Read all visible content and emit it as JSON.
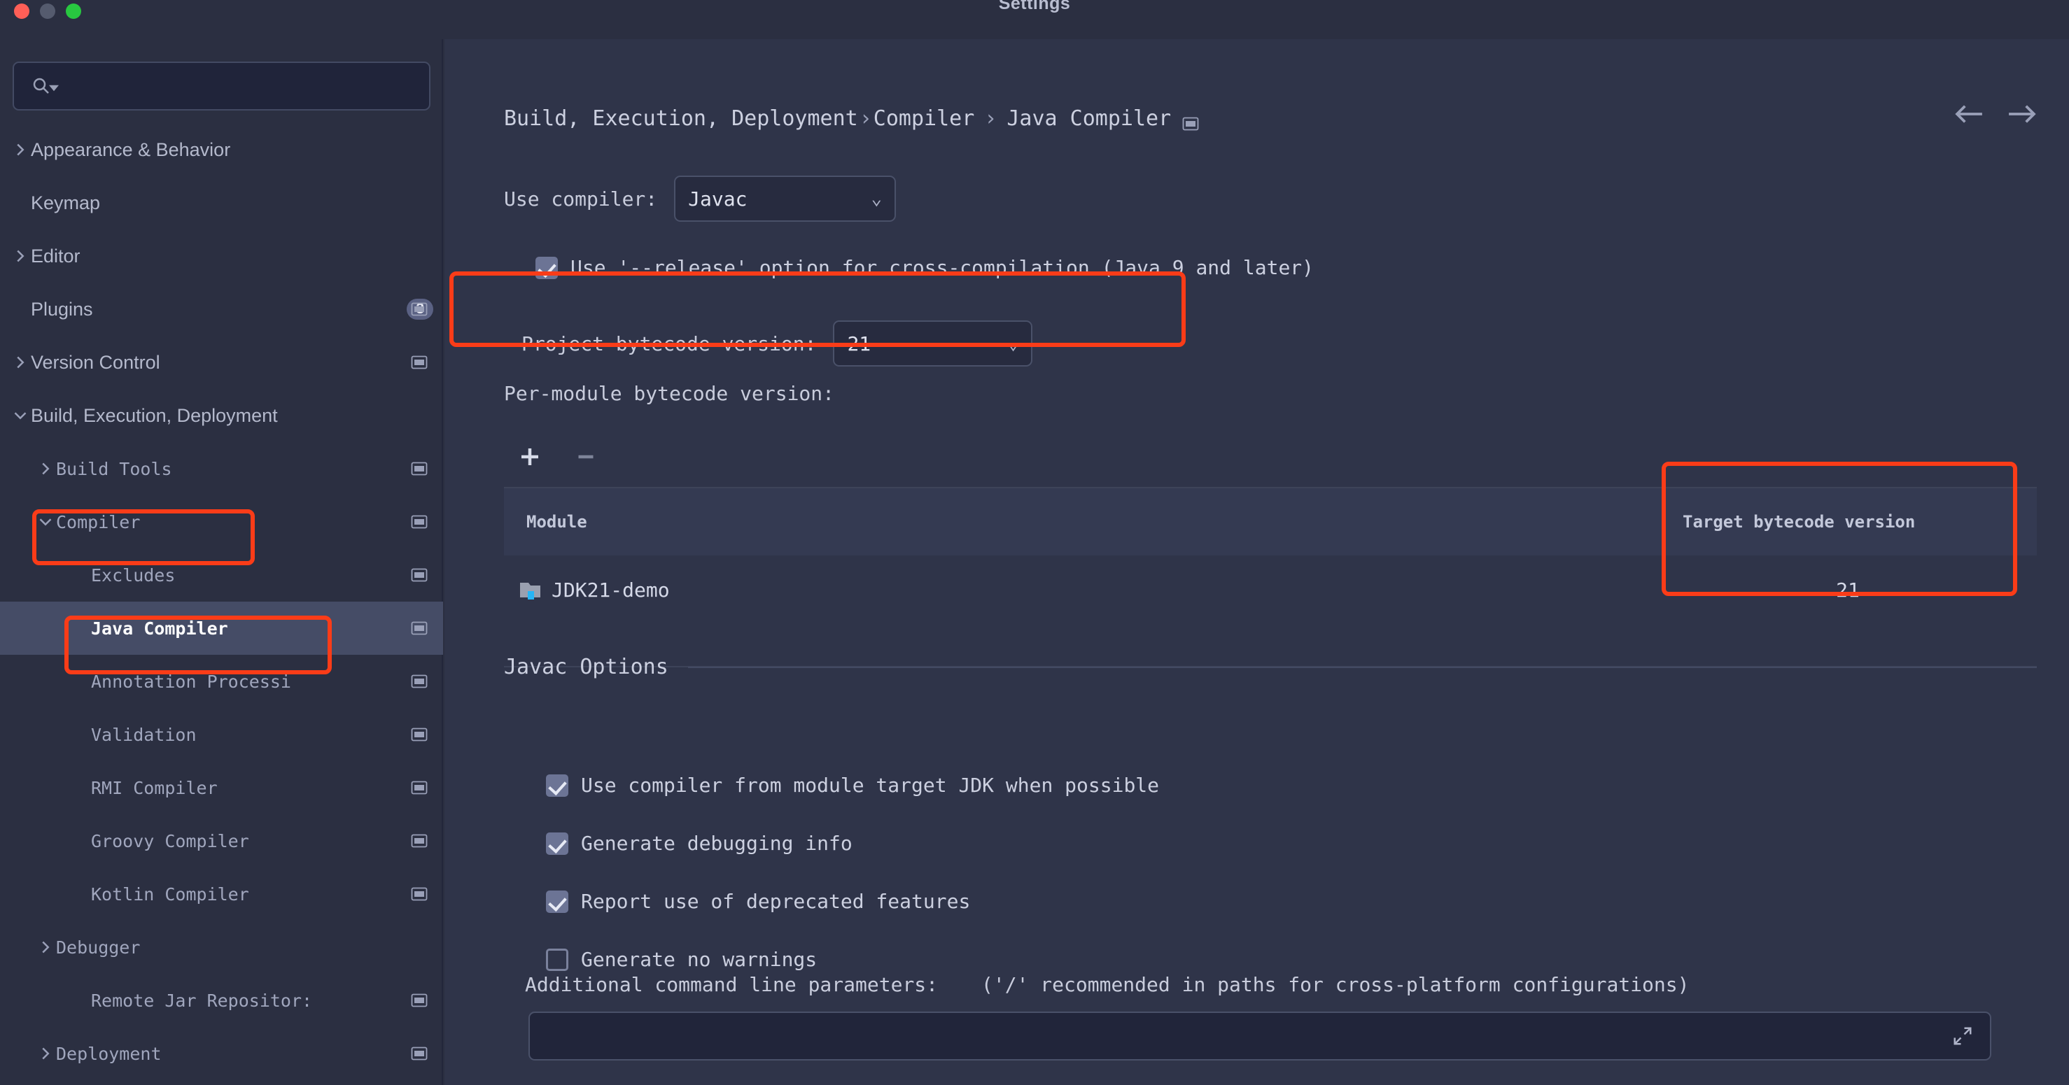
{
  "window": {
    "title": "Settings",
    "traffic_lights": [
      "close-red",
      "minimize-gray",
      "maximize-green"
    ]
  },
  "search": {
    "placeholder": "",
    "value": "",
    "icon": "search-icon"
  },
  "sidebar": {
    "items": [
      {
        "label": "Appearance & Behavior",
        "indent": 0,
        "chevron": "right",
        "panel_icon": false,
        "badge": null,
        "selected": false,
        "mono": false
      },
      {
        "label": "Keymap",
        "indent": 0,
        "chevron": "none",
        "panel_icon": false,
        "badge": null,
        "selected": false,
        "mono": false
      },
      {
        "label": "Editor",
        "indent": 0,
        "chevron": "right",
        "panel_icon": false,
        "badge": null,
        "selected": false,
        "mono": false
      },
      {
        "label": "Plugins",
        "indent": 0,
        "chevron": "none",
        "panel_icon": true,
        "badge": "3",
        "selected": false,
        "mono": false
      },
      {
        "label": "Version Control",
        "indent": 0,
        "chevron": "right",
        "panel_icon": true,
        "badge": null,
        "selected": false,
        "mono": false
      },
      {
        "label": "Build, Execution, Deployment",
        "indent": 0,
        "chevron": "down",
        "panel_icon": false,
        "badge": null,
        "selected": false,
        "mono": false
      },
      {
        "label": "Build Tools",
        "indent": 1,
        "chevron": "right",
        "panel_icon": true,
        "badge": null,
        "selected": false,
        "mono": true
      },
      {
        "label": "Compiler",
        "indent": 1,
        "chevron": "down",
        "panel_icon": true,
        "badge": null,
        "selected": false,
        "mono": true
      },
      {
        "label": "Excludes",
        "indent": 2,
        "chevron": "none",
        "panel_icon": true,
        "badge": null,
        "selected": false,
        "mono": true
      },
      {
        "label": "Java Compiler",
        "indent": 2,
        "chevron": "none",
        "panel_icon": true,
        "badge": null,
        "selected": true,
        "mono": true
      },
      {
        "label": "Annotation Processi",
        "indent": 2,
        "chevron": "none",
        "panel_icon": true,
        "badge": null,
        "selected": false,
        "mono": true
      },
      {
        "label": "Validation",
        "indent": 2,
        "chevron": "none",
        "panel_icon": true,
        "badge": null,
        "selected": false,
        "mono": true
      },
      {
        "label": "RMI Compiler",
        "indent": 2,
        "chevron": "none",
        "panel_icon": true,
        "badge": null,
        "selected": false,
        "mono": true
      },
      {
        "label": "Groovy Compiler",
        "indent": 2,
        "chevron": "none",
        "panel_icon": true,
        "badge": null,
        "selected": false,
        "mono": true
      },
      {
        "label": "Kotlin Compiler",
        "indent": 2,
        "chevron": "none",
        "panel_icon": true,
        "badge": null,
        "selected": false,
        "mono": true
      },
      {
        "label": "Debugger",
        "indent": 1,
        "chevron": "right",
        "panel_icon": false,
        "badge": null,
        "selected": false,
        "mono": true
      },
      {
        "label": "Remote Jar Repositor:",
        "indent": 2,
        "chevron": "none",
        "panel_icon": true,
        "badge": null,
        "selected": false,
        "mono": true
      },
      {
        "label": "Deployment",
        "indent": 1,
        "chevron": "right",
        "panel_icon": true,
        "badge": null,
        "selected": false,
        "mono": true
      }
    ]
  },
  "breadcrumb": {
    "part1": "Build, Execution, Deployment",
    "sep1": "›",
    "part2": "Compiler",
    "sep2": "›",
    "part3": "Java Compiler"
  },
  "nav": {
    "back": "←",
    "forward": "→"
  },
  "form": {
    "use_compiler_label": "Use compiler:",
    "use_compiler_value": "Javac",
    "release_option_label": "Use '--release' option for cross-compilation (Java 9 and later)",
    "release_option_checked": true,
    "project_bytecode_label": "Project bytecode version:",
    "project_bytecode_value": "21",
    "per_module_label": "Per-module bytecode version:",
    "add_button": "+",
    "remove_button": "−"
  },
  "table": {
    "columns": [
      "Module",
      "Target bytecode version"
    ],
    "rows": [
      {
        "module": "JDK21-demo",
        "target": "21"
      }
    ]
  },
  "javac": {
    "section_title": "Javac Options",
    "options": [
      {
        "label": "Use compiler from module target JDK when possible",
        "checked": true
      },
      {
        "label": "Generate debugging info",
        "checked": true
      },
      {
        "label": "Report use of deprecated features",
        "checked": true
      },
      {
        "label": "Generate no warnings",
        "checked": false
      }
    ],
    "additional_params_label": "Additional command line parameters:",
    "additional_params_hint": "('/' recommended in paths for cross-platform configurations)",
    "additional_params_value": "",
    "additional_params_placeholder": ""
  },
  "colors": {
    "accent_highlight": "#fa3c18",
    "window_bg": "#2b2f41",
    "main_bg": "#2f3449",
    "selected_row": "#454c66",
    "checkbox_on": "#6c7495"
  }
}
